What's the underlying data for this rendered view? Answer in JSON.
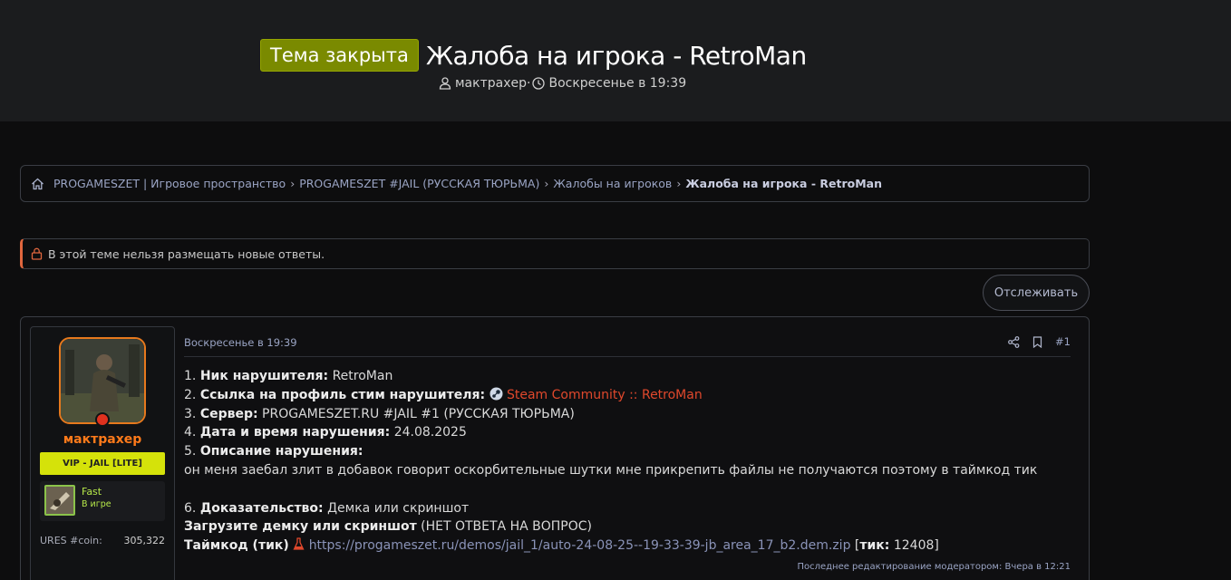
{
  "thread": {
    "prefix": "Тема закрыта",
    "title": "Жалоба на игрока - RetroMan",
    "author": "мактрахер",
    "author_sep": "·",
    "date": "Воскресенье в 19:39"
  },
  "breadcrumbs": [
    "PROGAMESZET | Игровое пространство",
    "PROGAMESZET #JAIL (РУССКАЯ ТЮРЬМА)",
    "Жалобы на игроков",
    "Жалоба на игрока - RetroMan"
  ],
  "notice": "В этой теме нельзя размещать новые ответы.",
  "watch_button": "Отслеживать",
  "post": {
    "user": {
      "name": "мактрахер",
      "title": "VIP - JAIL [LITE]",
      "game_name": "Fast",
      "game_status": "В игре",
      "coin_label": "URES #coin:",
      "coin_value": "305,322"
    },
    "date": "Воскресенье в 19:39",
    "number": "#1",
    "body": {
      "l1_num": "1.",
      "l1_label": "Ник нарушителя:",
      "l1_value": "RetroMan",
      "l2_num": "2.",
      "l2_label": "Ссылка на профиль стим нарушителя:",
      "l2_value": "Steam Community :: RetroMan",
      "l3_num": "3.",
      "l3_label": "Сервер:",
      "l3_value": "PROGAMESZET.RU #JAIL #1 (РУССКАЯ ТЮРЬМА)",
      "l4_num": "4.",
      "l4_label": "Дата и время нарушения:",
      "l4_value": "24.08.2025",
      "l5_num": "5.",
      "l5_label": "Описание нарушения:",
      "l5_text": "он меня заебал злит в добавок говорит оскорбительные шутки мне прикрепить файлы не получаются поэтому в таймкод тик",
      "l6_num": "6.",
      "l6_label": "Доказательство:",
      "l6_value": "Демка или скриншот",
      "l7_label": "Загрузите демку или скриншот",
      "l7_value": "(НЕТ ОТВЕТА НА ВОПРОС)",
      "l8_label": "Таймкод (тик)",
      "l8_url": "https://progameszet.ru/demos/jail_1/auto-24-08-25--19-33-39-jb_area_17_b2.dem.zip",
      "l8_tick_open": "[",
      "l8_tick_label": "тик:",
      "l8_tick_value": "12408",
      "l8_tick_close": "]"
    },
    "edit_note": "Последнее редактирование модератором: Вчера в 12:21"
  },
  "colors": {
    "prefix_bg": "#7a8a00",
    "username": "#ff7a1a",
    "user_title_bg": "#d5e20a",
    "link_red": "#e0482c",
    "notice_accent": "#e0663e"
  },
  "icons": [
    "user-icon",
    "clock-icon",
    "home-icon",
    "lock-icon",
    "share-icon",
    "bookmark-icon",
    "steam-icon",
    "flask-icon"
  ]
}
